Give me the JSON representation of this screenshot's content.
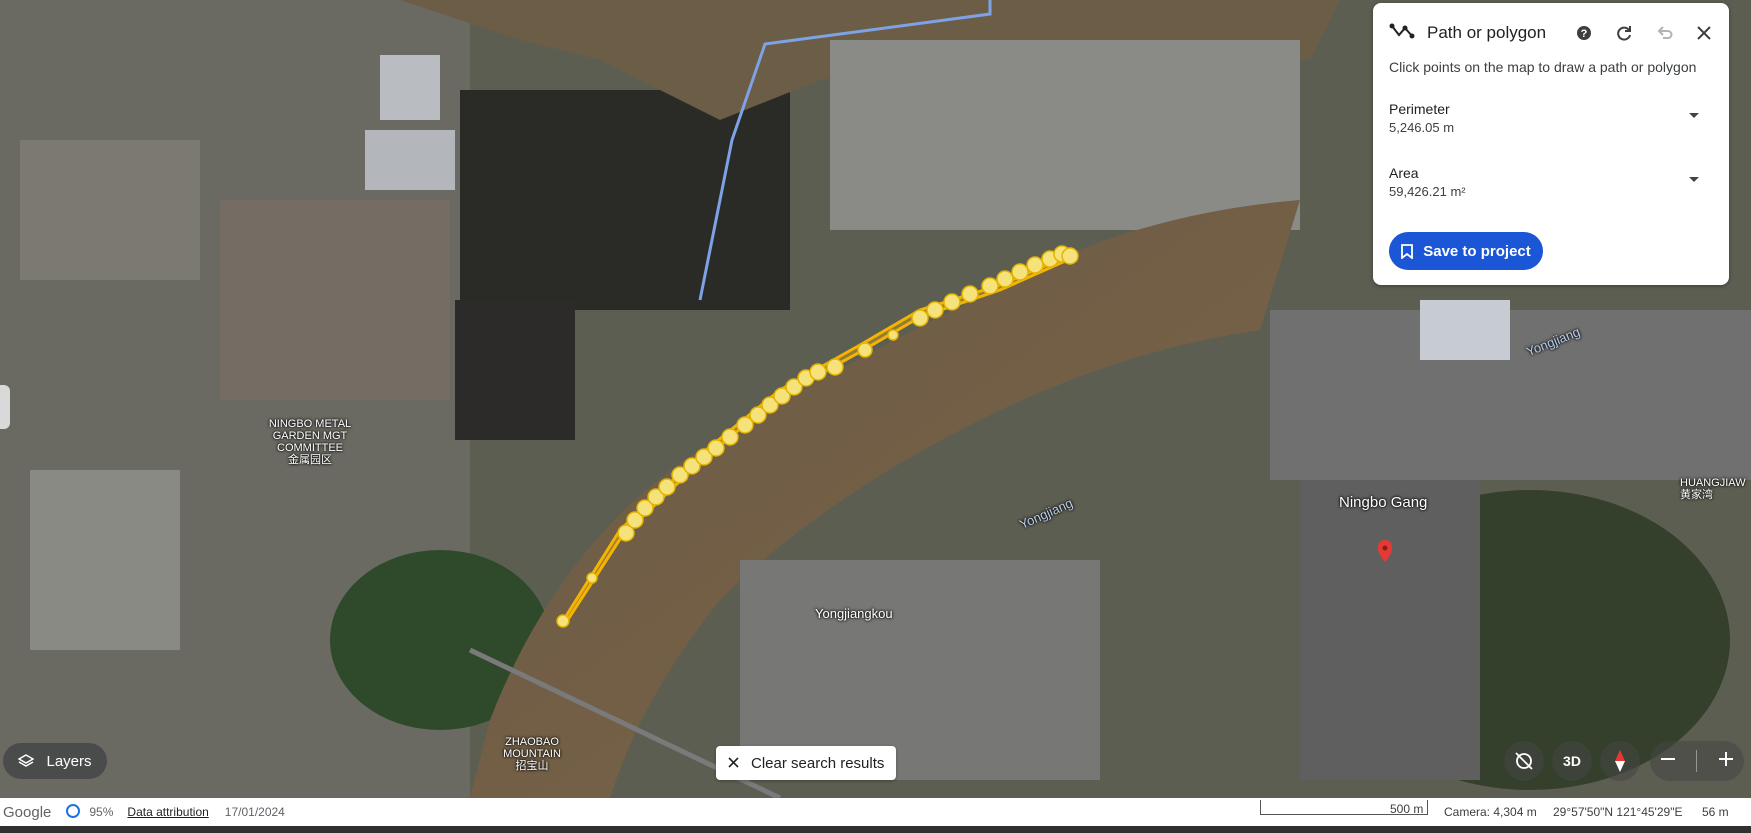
{
  "panel": {
    "title": "Path or polygon",
    "hint": "Click points on the map to draw a path or polygon",
    "perimeter_label": "Perimeter",
    "perimeter_value": "5,246.05 m",
    "area_label": "Area",
    "area_value": "59,426.21 m²",
    "save_label": "Save to project"
  },
  "map_labels": {
    "ningbo_metal": "NINGBO METAL GARDEN MGT COMMITTEE",
    "ningbo_metal_cn": "金属园区",
    "yongjiangkou": "Yongjiangkou",
    "yongjiang_1": "Yongjiang",
    "yongjiang_2": "Yongjiang",
    "ningbo_gang": "Ningbo Gang",
    "huangjiawan": "HUANGJIAW",
    "huangjiawan_cn": "黄家湾",
    "zhaobao": "ZHAOBAO MOUNTAIN",
    "zhaobao_cn": "招宝山"
  },
  "controls": {
    "layers_label": "Layers",
    "clear_search_label": "Clear search results",
    "btn_3d_label": "3D"
  },
  "status_bar": {
    "google": "Google",
    "load_percent": "95%",
    "attribution": "Data attribution",
    "date": "17/01/2024",
    "scale": "500 m",
    "camera": "Camera: 4,304 m",
    "coords": "29°57'50\"N 121°45'29\"E",
    "elevation": "56 m"
  },
  "colors": {
    "path": "#f5b400",
    "accent": "#1a56d6",
    "marker": "#e53935"
  }
}
